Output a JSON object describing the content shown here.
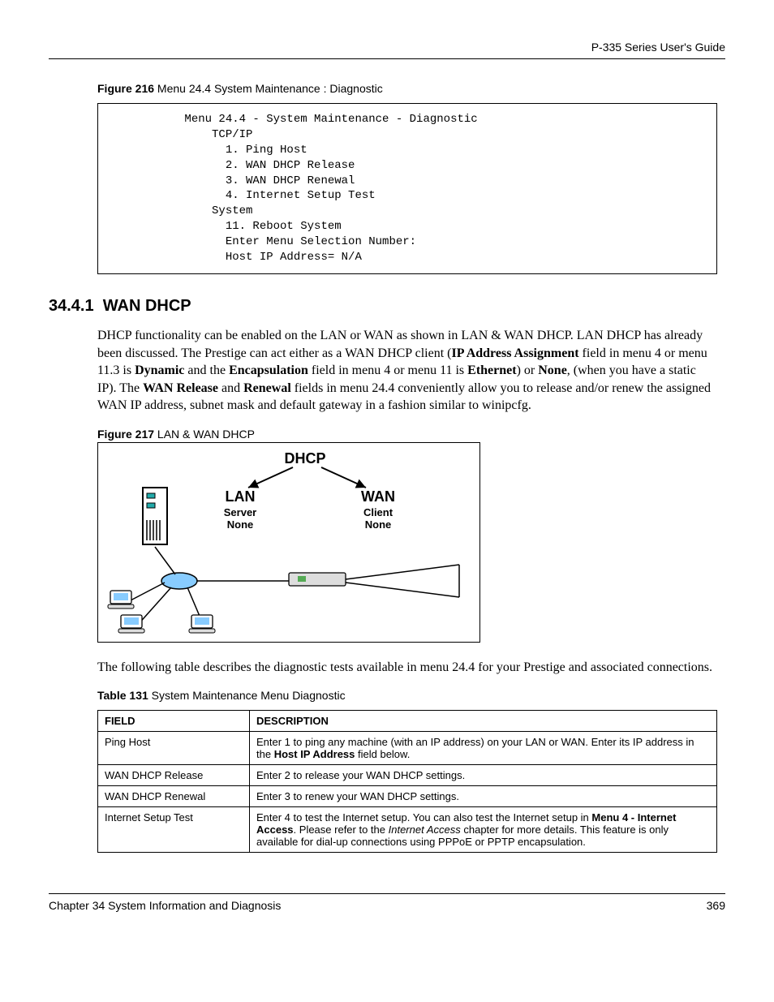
{
  "header": {
    "guide": "P-335 Series User's Guide"
  },
  "figure216": {
    "caption_bold": "Figure 216",
    "caption_rest": "   Menu 24.4 System Maintenance : Diagnostic",
    "lines": [
      "           Menu 24.4 - System Maintenance - Diagnostic",
      "               TCP/IP",
      "                 1. Ping Host",
      "                 2. WAN DHCP Release",
      "                 3. WAN DHCP Renewal",
      "                 4. Internet Setup Test",
      "               System",
      "                 11. Reboot System",
      "                 Enter Menu Selection Number:",
      "                 Host IP Address= N/A"
    ]
  },
  "section": {
    "number": "34.4.1",
    "title": "WAN DHCP"
  },
  "para1": {
    "t1": "DHCP functionality can be enabled on the LAN or WAN as shown in LAN & WAN DHCP. LAN DHCP has already been discussed. The Prestige can act either as a WAN DHCP client (",
    "b1": "IP Address Assignment",
    "t2": " field in menu 4 or menu 11.3 is ",
    "b2": "Dynamic",
    "t3": " and the ",
    "b3": "Encapsulation",
    "t4": " field in menu 4 or menu 11 is ",
    "b4": "Ethernet",
    "t5": ") or ",
    "b5": "None",
    "t6": ", (when you have a static IP). The ",
    "b6": "WAN Release",
    "t7": " and ",
    "b7": "Renewal",
    "t8": " fields in menu 24.4 conveniently allow you to release and/or renew the assigned WAN IP address, subnet mask and default gateway in a fashion similar to winipcfg."
  },
  "figure217": {
    "caption_bold": "Figure 217",
    "caption_rest": "   LAN & WAN DHCP",
    "labels": {
      "dhcp": "DHCP",
      "lan": "LAN",
      "wan": "WAN",
      "server": "Server",
      "none": "None",
      "client": "Client"
    }
  },
  "para2": "The following table describes the diagnostic tests available in menu 24.4 for your Prestige and associated connections.",
  "table131": {
    "caption_bold": "Table 131",
    "caption_rest": "   System Maintenance Menu Diagnostic",
    "head": {
      "c1": "FIELD",
      "c2": "DESCRIPTION"
    },
    "rows": [
      {
        "field": "Ping Host",
        "d1": "Enter 1 to ping any machine (with an IP address) on your LAN or WAN. Enter its IP address in the ",
        "b1": "Host IP Address",
        "d2": " field below."
      },
      {
        "field": "WAN DHCP Release",
        "d1": "Enter 2 to release your WAN DHCP settings."
      },
      {
        "field": "WAN DHCP Renewal",
        "d1": "Enter 3 to renew your WAN DHCP settings."
      },
      {
        "field": "Internet Setup Test",
        "d1": "Enter 4 to test the Internet setup. You can also test the Internet setup in ",
        "b1": "Menu 4 - Internet Access",
        "d2": ". Please refer to the ",
        "i1": "Internet Access",
        "d3": " chapter for more details. This feature is only available for dial-up connections using PPPoE or PPTP encapsulation."
      }
    ]
  },
  "footer": {
    "chapter": "Chapter 34 System Information and Diagnosis",
    "page": "369"
  }
}
